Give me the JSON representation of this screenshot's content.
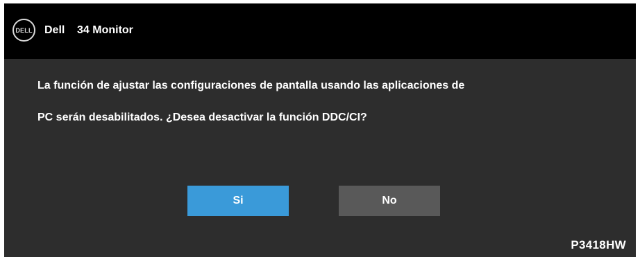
{
  "header": {
    "logo_text": "DELL",
    "brand": "Dell",
    "model": "34 Monitor"
  },
  "message": {
    "line1": "La función de ajustar las configuraciones de pantalla usando las aplicaciones de",
    "line2": "PC serán desabilitados. ¿Desea desactivar la función DDC/CI?"
  },
  "buttons": {
    "yes_label": "Si",
    "no_label": "No"
  },
  "footer": {
    "model_code": "P3418HW"
  },
  "colors": {
    "header_bg": "#000000",
    "panel_bg": "#2d2d2d",
    "yes_button": "#3a9ad9",
    "no_button": "#595959",
    "text": "#ffffff"
  }
}
